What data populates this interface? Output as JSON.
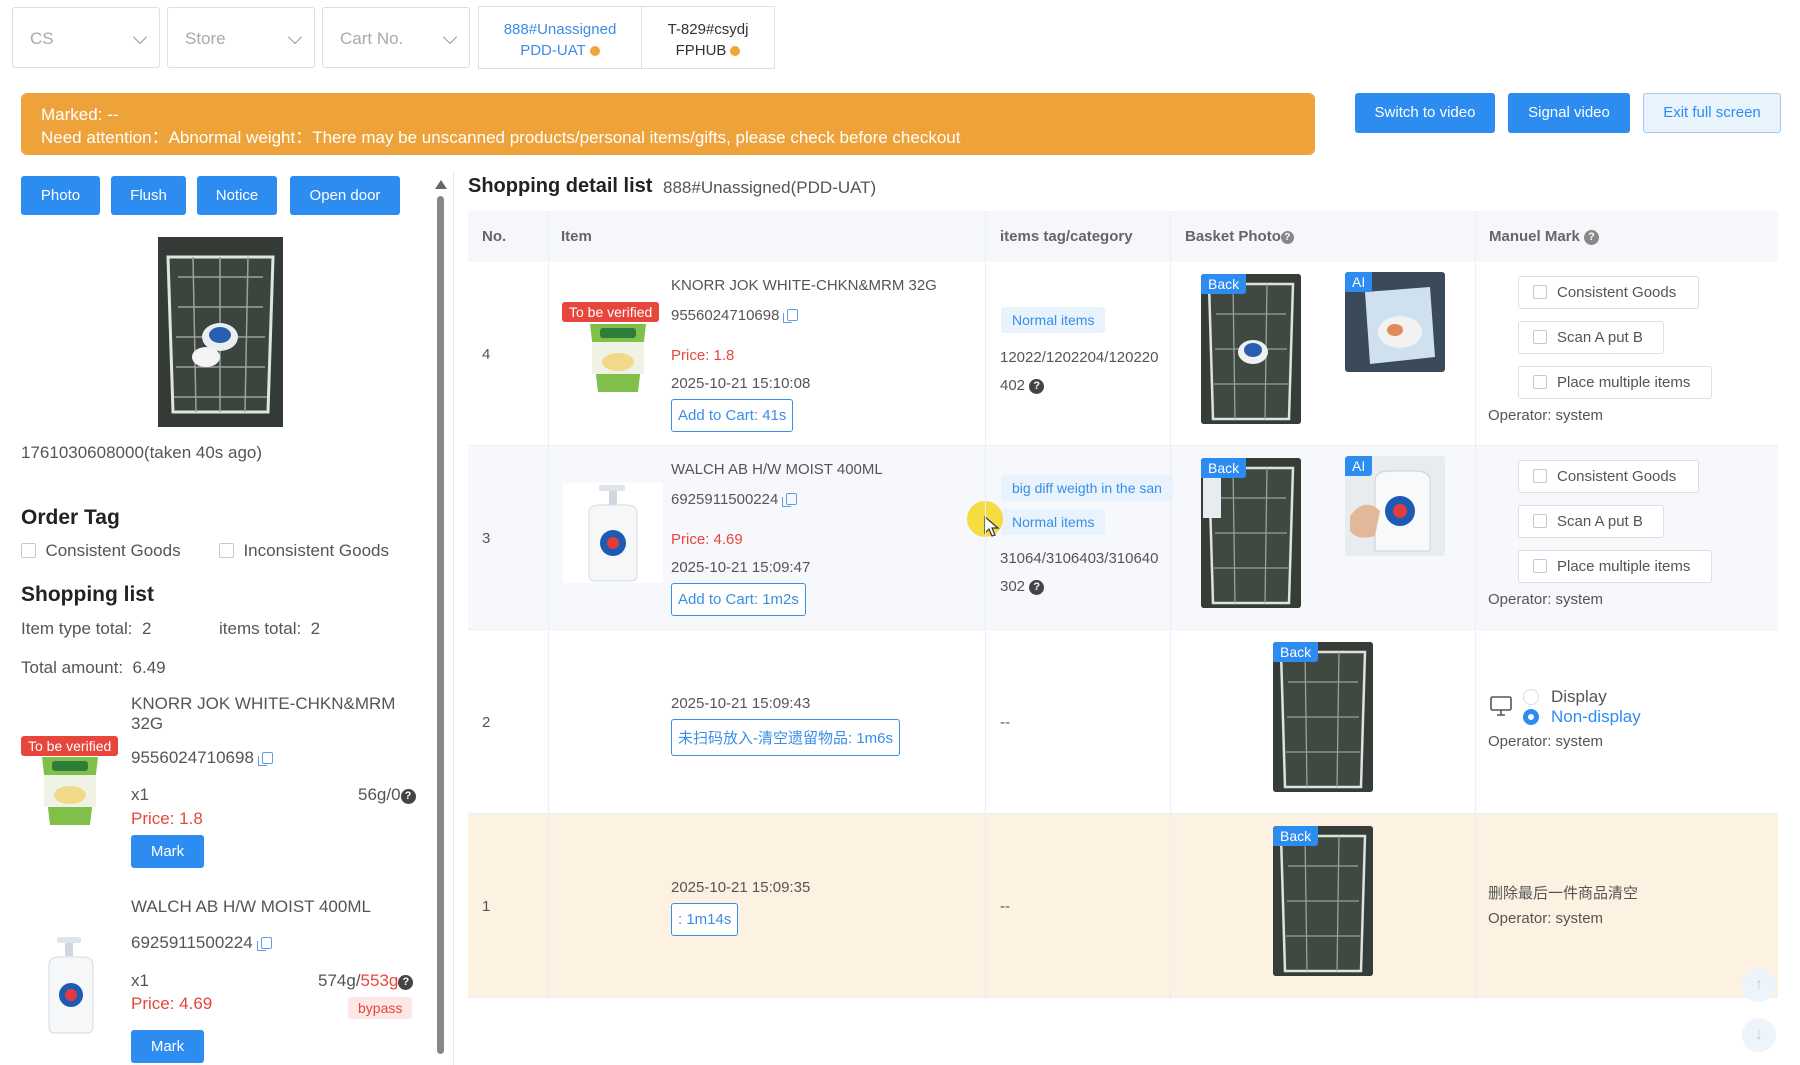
{
  "filters": {
    "cs_placeholder": "CS",
    "store_placeholder": "Store",
    "cart_placeholder": "Cart No."
  },
  "tabs": [
    {
      "line1": "888#Unassigned",
      "line2": "PDD-UAT",
      "active": true
    },
    {
      "line1": "T-829#csydj",
      "line2": "FPHUB",
      "active": false
    }
  ],
  "banner": {
    "marked": "Marked: --",
    "attention": "Need attention：Abnormal weight：There may be unscanned products/personal items/gifts, please check before checkout"
  },
  "top_actions": {
    "switch_video": "Switch to video",
    "signal_video": "Signal video",
    "exit_full": "Exit full screen"
  },
  "left": {
    "buttons": {
      "photo": "Photo",
      "flush": "Flush",
      "notice": "Notice",
      "open_door": "Open door"
    },
    "photo_caption": "1761030608000(taken 40s ago)",
    "order_tag_title": "Order Tag",
    "order_tags": [
      "Consistent Goods",
      "Inconsistent Goods"
    ],
    "shopping_list_title": "Shopping list",
    "item_type_label": "Item type total:",
    "item_type_value": "2",
    "items_total_label": "items total:",
    "items_total_value": "2",
    "total_amount_label": "Total amount:",
    "total_amount_value": "6.49",
    "items": [
      {
        "name": "KNORR JOK WHITE-CHKN&MRM 32G",
        "badge": "To be verified",
        "barcode": "9556024710698",
        "qty": "x1",
        "weight": "56g/0",
        "weight_alt": "",
        "price": "Price: 1.8",
        "bypass": "",
        "mark": "Mark"
      },
      {
        "name": "WALCH AB H/W MOIST 400ML",
        "badge": "",
        "barcode": "6925911500224",
        "qty": "x1",
        "weight": "574g/",
        "weight_alt": "553g",
        "price": "Price: 4.69",
        "bypass": "bypass",
        "mark": "Mark"
      }
    ]
  },
  "detail": {
    "title": "Shopping detail list",
    "subtitle": "888#Unassigned(PDD-UAT)",
    "columns": {
      "no": "No.",
      "item": "Item",
      "tag": "items tag/category",
      "basket": "Basket Photo",
      "mark": "Manuel Mark"
    },
    "rows": [
      {
        "no": "4",
        "badge": "To be verified",
        "name": "KNORR JOK WHITE-CHKN&MRM 32G",
        "barcode": "9556024710698",
        "price": "Price: 1.8",
        "time": "2025-10-21 15:10:08",
        "cart_tag": "Add to Cart: 41s",
        "tags": [
          "Normal items"
        ],
        "category_a": "12022/1202204/120220",
        "category_b": "402",
        "back": "Back",
        "ai": "AI",
        "marks": [
          "Consistent Goods",
          "Scan A put B",
          "Place multiple items"
        ],
        "operator": "Operator: system"
      },
      {
        "no": "3",
        "name": "WALCH AB H/W MOIST 400ML",
        "barcode": "6925911500224",
        "price": "Price: 4.69",
        "time": "2025-10-21 15:09:47",
        "cart_tag": "Add to Cart: 1m2s",
        "tags": [
          "big diff weigth in the san",
          "Normal items"
        ],
        "category_a": "31064/3106403/310640",
        "category_b": "302",
        "back": "Back",
        "ai": "AI",
        "marks": [
          "Consistent Goods",
          "Scan A put B",
          "Place multiple items"
        ],
        "operator": "Operator: system"
      },
      {
        "no": "2",
        "time": "2025-10-21 15:09:43",
        "cart_tag": "未扫码放入-清空遗留物品: 1m6s",
        "dash": "--",
        "back": "Back",
        "display": "Display",
        "non_display": "Non-display",
        "operator": "Operator: system"
      },
      {
        "no": "1",
        "time": "2025-10-21 15:09:35",
        "cart_tag": ": 1m14s",
        "dash": "--",
        "back": "Back",
        "note": "删除最后一件商品清空",
        "operator": "Operator: system"
      }
    ]
  },
  "colors": {
    "accent": "#2d8cf0",
    "warning": "#eea23a",
    "danger": "#e8453c",
    "highlight_row": "#fdf1e1"
  }
}
